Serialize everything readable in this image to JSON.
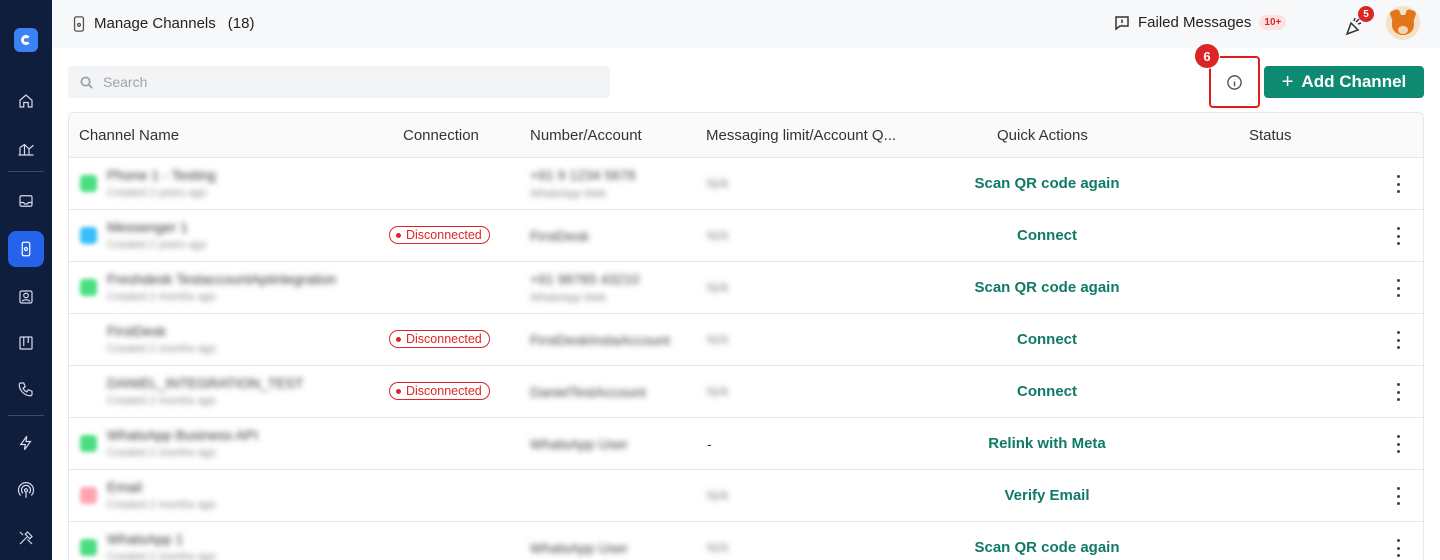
{
  "header": {
    "title": "Manage Channels",
    "count": "(18)",
    "failed_label": "Failed Messages",
    "failed_badge": "10+",
    "notification_count": "5"
  },
  "search": {
    "placeholder": "Search",
    "value": ""
  },
  "step_marker": "6",
  "add_button": {
    "label": "Add Channel"
  },
  "table": {
    "columns": [
      "Channel Name",
      "Connection",
      "Number/Account",
      "Messaging limit/Account Q...",
      "Quick Actions",
      "Status"
    ],
    "rows": [
      {
        "name": "Phone 1 - Testing",
        "sub": "Created 2 years ago",
        "icon_color": "#4ade80",
        "connection": "",
        "number": "+91 9 1234 5678",
        "number_sub": "WhatsApp Web",
        "limit": "N/A",
        "action": "Scan QR code again"
      },
      {
        "name": "Messenger 1",
        "sub": "Created 2 years ago",
        "icon_color": "#38bdf8",
        "connection": "Disconnected",
        "number": "FirstDesk",
        "number_sub": "",
        "limit": "N/A",
        "action": "Connect"
      },
      {
        "name": "Freshdesk TestaccountApiintegration",
        "sub": "Created 2 months ago",
        "icon_color": "#4ade80",
        "connection": "",
        "number": "+91 98765 43210",
        "number_sub": "WhatsApp Web",
        "limit": "N/A",
        "action": "Scan QR code again"
      },
      {
        "name": "FirstDesk",
        "sub": "Created 2 months ago",
        "icon_color": "",
        "connection": "Disconnected",
        "number": "FirstDeskInstaAccount",
        "number_sub": "",
        "limit": "N/A",
        "action": "Connect"
      },
      {
        "name": "DANIEL_INTEGRATION_TEST",
        "sub": "Created 2 months ago",
        "icon_color": "",
        "connection": "Disconnected",
        "number": "DanielTestAccount",
        "number_sub": "",
        "limit": "N/A",
        "action": "Connect"
      },
      {
        "name": "WhatsApp Business API",
        "sub": "Created 2 months ago",
        "icon_color": "#4ade80",
        "connection": "",
        "number": "WhatsApp User",
        "number_sub": "",
        "limit": "-",
        "action": "Relink with Meta"
      },
      {
        "name": "Email",
        "sub": "Created 2 months ago",
        "icon_color": "#fda4af",
        "connection": "",
        "number": "",
        "number_sub": "",
        "limit": "N/A",
        "action": "Verify Email"
      },
      {
        "name": "WhatsApp 1",
        "sub": "Created 2 months ago",
        "icon_color": "#4ade80",
        "connection": "",
        "number": "WhatsApp User",
        "number_sub": "",
        "limit": "N/A",
        "action": "Scan QR code again"
      }
    ]
  },
  "sidebar": {
    "items": [
      {
        "icon": "home-icon"
      },
      {
        "icon": "analytics-icon"
      },
      {
        "icon": "inbox-icon"
      },
      {
        "icon": "channels-icon",
        "active": true
      },
      {
        "icon": "contacts-icon"
      },
      {
        "icon": "board-icon"
      },
      {
        "icon": "phone-icon"
      },
      {
        "icon": "automation-icon"
      },
      {
        "icon": "broadcast-icon"
      },
      {
        "icon": "tools-icon"
      }
    ]
  },
  "colors": {
    "accent": "#0f8a72",
    "sidebar": "#0f1e3d",
    "active": "#2563eb",
    "danger": "#dc2626"
  }
}
